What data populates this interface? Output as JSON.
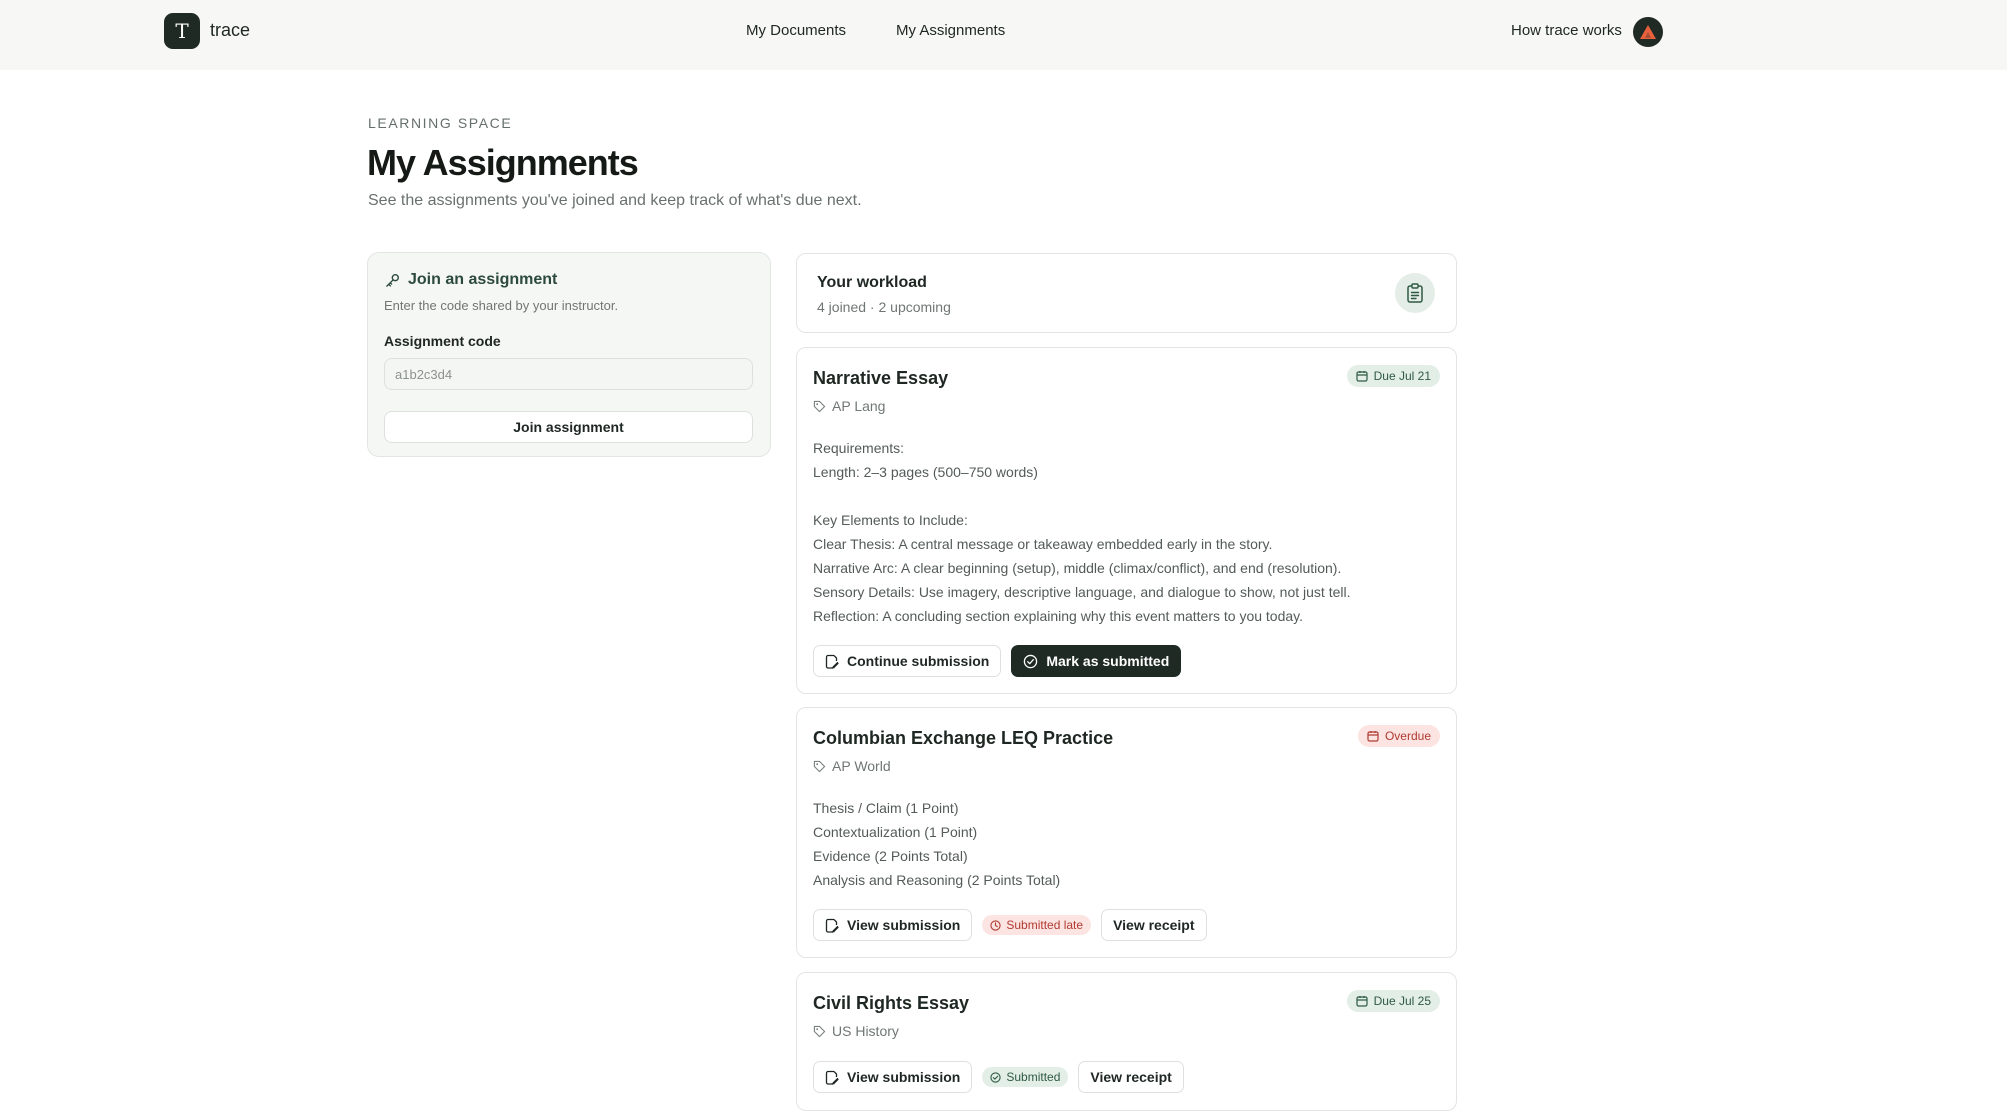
{
  "header": {
    "logo_letter": "T",
    "app_name": "trace",
    "nav": [
      "My Documents",
      "My Assignments"
    ],
    "help_link": "How trace works"
  },
  "page": {
    "eyebrow": "LEARNING SPACE",
    "title": "My Assignments",
    "subtitle": "See the assignments you've joined and keep track of what's due next."
  },
  "join": {
    "title": "Join an assignment",
    "subtitle": "Enter the code shared by your instructor.",
    "field_label": "Assignment code",
    "placeholder": "a1b2c3d4",
    "button": "Join assignment"
  },
  "workload": {
    "title": "Your workload",
    "meta": "4 joined · 2 upcoming"
  },
  "assignments": [
    {
      "title": "Narrative Essay",
      "course": "AP Lang",
      "due_badge": "Due Jul 21",
      "description": [
        "Requirements:",
        "Length: 2–3 pages (500–750 words)",
        "",
        "Key Elements to Include:",
        "Clear Thesis: A central message or takeaway embedded early in the story.",
        "Narrative Arc: A clear beginning (setup), middle (climax/conflict), and end (resolution).",
        "Sensory Details: Use imagery, descriptive language, and dialogue to show, not just tell.",
        "Reflection: A concluding section explaining why this event matters to you today."
      ],
      "primary_action": "Continue submission",
      "secondary_action": "Mark as submitted"
    },
    {
      "title": "Columbian Exchange LEQ Practice",
      "course": "AP World",
      "due_badge": "Overdue",
      "description": [
        "Thesis / Claim (1 Point)",
        "Contextualization (1 Point)",
        "Evidence (2 Points Total)",
        "Analysis and Reasoning (2 Points Total)"
      ],
      "primary_action": "View submission",
      "status": "Submitted late",
      "receipt_action": "View receipt"
    },
    {
      "title": "Civil Rights Essay",
      "course": "US History",
      "due_badge": "Due Jul 25",
      "description": [],
      "primary_action": "View submission",
      "status": "Submitted",
      "receipt_action": "View receipt"
    }
  ],
  "colors": {
    "brand_dark": "#1f2a25",
    "accent_green": "#2e5a42",
    "overdue_red": "#b13b31",
    "avatar_triangle": "#e8603c"
  }
}
